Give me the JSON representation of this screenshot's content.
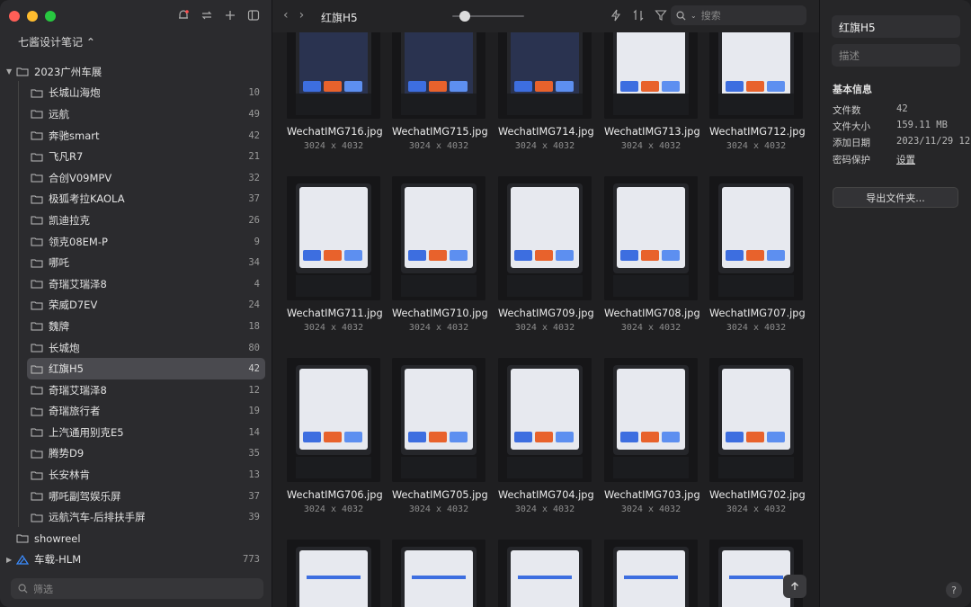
{
  "sidebar": {
    "library_title": "七酱设计笔记 ⌃",
    "parent_folder": "2023广州车展",
    "children": [
      {
        "label": "长城山海炮",
        "count": "10"
      },
      {
        "label": "远航",
        "count": "49"
      },
      {
        "label": "奔驰smart",
        "count": "42"
      },
      {
        "label": "飞凡R7",
        "count": "21"
      },
      {
        "label": "合创V09MPV",
        "count": "32"
      },
      {
        "label": "极狐考拉KAOLA",
        "count": "37"
      },
      {
        "label": "凯迪拉克",
        "count": "26"
      },
      {
        "label": "领克08EM-P",
        "count": "9"
      },
      {
        "label": "哪吒",
        "count": "34"
      },
      {
        "label": "奇瑞艾瑞泽8",
        "count": "4"
      },
      {
        "label": "荣威D7EV",
        "count": "24"
      },
      {
        "label": "魏牌",
        "count": "18"
      },
      {
        "label": "长城炮",
        "count": "80"
      },
      {
        "label": "红旗H5",
        "count": "42"
      },
      {
        "label": "奇瑞艾瑞泽8",
        "count": "12"
      },
      {
        "label": "奇瑞旅行者",
        "count": "19"
      },
      {
        "label": "上汽通用别克E5",
        "count": "14"
      },
      {
        "label": "腾势D9",
        "count": "35"
      },
      {
        "label": "长安林肯",
        "count": "13"
      },
      {
        "label": "哪吒副驾娱乐屏",
        "count": "37"
      },
      {
        "label": "远航汽车-后排扶手屏",
        "count": "39"
      }
    ],
    "showreel": "showreel",
    "hlm": {
      "label": "车载-HLM",
      "count": "773"
    },
    "filter_placeholder": "筛选"
  },
  "toolbar": {
    "folder_title": "红旗H5",
    "zoom_level": 0.1,
    "search_placeholder": "搜索"
  },
  "files": [
    {
      "name": "WechatIMG716.jpg",
      "dims": "3024 x 4032"
    },
    {
      "name": "WechatIMG715.jpg",
      "dims": "3024 x 4032"
    },
    {
      "name": "WechatIMG714.jpg",
      "dims": "3024 x 4032"
    },
    {
      "name": "WechatIMG713.jpg",
      "dims": "3024 x 4032"
    },
    {
      "name": "WechatIMG712.jpg",
      "dims": "3024 x 4032"
    },
    {
      "name": "WechatIMG711.jpg",
      "dims": "3024 x 4032"
    },
    {
      "name": "WechatIMG710.jpg",
      "dims": "3024 x 4032"
    },
    {
      "name": "WechatIMG709.jpg",
      "dims": "3024 x 4032"
    },
    {
      "name": "WechatIMG708.jpg",
      "dims": "3024 x 4032"
    },
    {
      "name": "WechatIMG707.jpg",
      "dims": "3024 x 4032"
    },
    {
      "name": "WechatIMG706.jpg",
      "dims": "3024 x 4032"
    },
    {
      "name": "WechatIMG705.jpg",
      "dims": "3024 x 4032"
    },
    {
      "name": "WechatIMG704.jpg",
      "dims": "3024 x 4032"
    },
    {
      "name": "WechatIMG703.jpg",
      "dims": "3024 x 4032"
    },
    {
      "name": "WechatIMG702.jpg",
      "dims": "3024 x 4032"
    }
  ],
  "inspector": {
    "name": "红旗H5",
    "description_placeholder": "描述",
    "section_title": "基本信息",
    "rows": [
      {
        "label": "文件数",
        "value": "42"
      },
      {
        "label": "文件大小",
        "value": "159.11 MB"
      },
      {
        "label": "添加日期",
        "value": "2023/11/29 12:"
      },
      {
        "label": "密码保护",
        "value": "设置"
      }
    ],
    "export_label": "导出文件夹...",
    "help": "?"
  },
  "colors": {
    "sidebar_bg": "#2b2b2e",
    "main_bg": "#1f1f21",
    "selected_row": "#4a4a4f",
    "screen_accent_orange": "#e8622c",
    "screen_accent_blue": "#3d6ee0"
  },
  "icons": [
    "bell-icon",
    "sync-icon",
    "plus-icon",
    "sidebar-toggle-icon",
    "back-icon",
    "forward-icon",
    "flash-icon",
    "sort-icon",
    "filter-icon",
    "search-icon",
    "folder-icon",
    "arrow-up-icon"
  ]
}
